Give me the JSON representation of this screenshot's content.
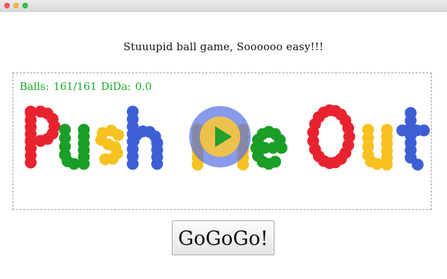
{
  "heading": "Stuuupid ball game, Soooooo easy!!!",
  "stats": {
    "balls_label": "Balls:",
    "balls_value": "161/161",
    "dida_label": "DiDa:",
    "dida_value": "0.0"
  },
  "button": {
    "label": "GoGoGo!"
  },
  "colors": {
    "red": "#e8232f",
    "green": "#1a9e28",
    "yellow": "#f7c21f",
    "blue": "#3d5fd6",
    "stats_text": "#1aaa2a"
  },
  "icons": [
    "play-icon"
  ]
}
